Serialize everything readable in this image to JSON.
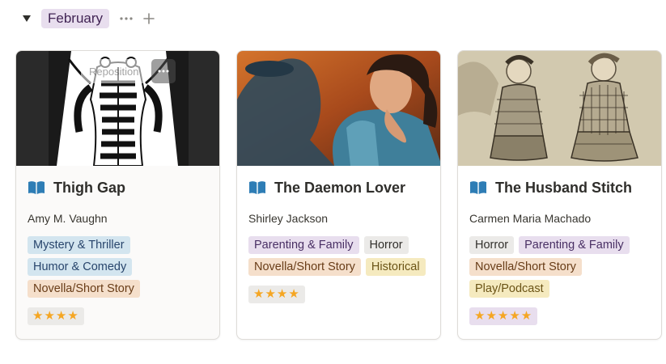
{
  "group": {
    "label": "February",
    "toggle_icon": "triangle-down-icon",
    "more_icon": "ellipsis-icon",
    "add_icon": "plus-icon"
  },
  "colors": {
    "book_icon": "#2e7db5",
    "star": "#f5a623"
  },
  "cover_overlay": {
    "reposition_label": "Reposition",
    "more_icon": "ellipsis-icon"
  },
  "cards": [
    {
      "title": "Thigh Gap",
      "icon": "open-book-icon",
      "author": "Amy M. Vaughn",
      "tags": [
        "Mystery & Thriller",
        "Humor & Comedy",
        "Novella/Short Story"
      ],
      "rating": "★★★★"
    },
    {
      "title": "The Daemon Lover",
      "icon": "open-book-icon",
      "author": "Shirley Jackson",
      "tags": [
        "Parenting & Family",
        "Horror",
        "Novella/Short Story",
        "Historical"
      ],
      "rating": "★★★★"
    },
    {
      "title": "The Husband Stitch",
      "icon": "open-book-icon",
      "author": "Carmen Maria Machado",
      "tags": [
        "Horror",
        "Parenting & Family",
        "Novella/Short Story",
        "Play/Podcast"
      ],
      "rating": "★★★★★"
    }
  ]
}
